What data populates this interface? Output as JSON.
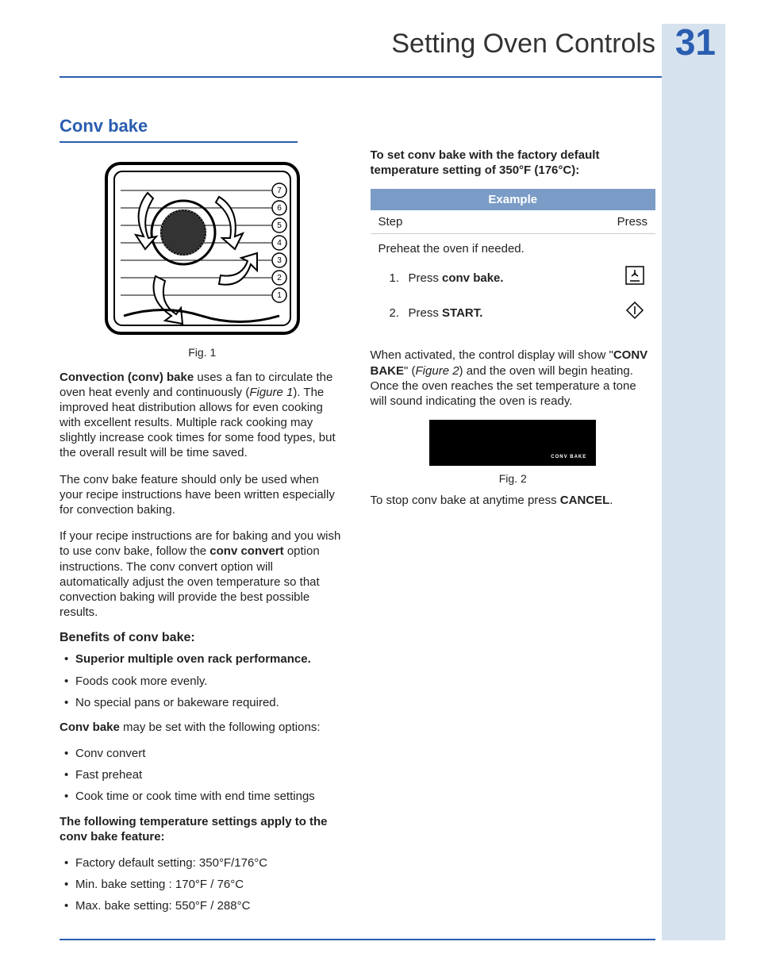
{
  "header": {
    "title": "Setting Oven Controls",
    "page_number": "31"
  },
  "section": {
    "heading": "Conv bake"
  },
  "fig1": {
    "caption": "Fig. 1",
    "rack_labels": [
      "7",
      "6",
      "5",
      "4",
      "3",
      "2",
      "1"
    ]
  },
  "left": {
    "p1_a": "Convection (conv) bake",
    "p1_b": " uses a fan to circulate the oven heat evenly and continuously (",
    "p1_c": "Figure 1",
    "p1_d": "). The improved heat distribution allows for even cooking with excellent results. Multiple rack cooking may slightly increase cook times for some food types, but the overall result will be time saved.",
    "p2": "The conv bake feature should only be used when your recipe instructions have been written especially for convection baking.",
    "p3_a": "If your recipe instructions are for baking and you wish to use conv bake, follow the ",
    "p3_b": "conv convert",
    "p3_c": " option instructions. The conv convert option will automatically adjust the oven temperature so that convection baking will provide the best possible results.",
    "benefits_heading": "Benefits of conv bake:",
    "benefits": [
      {
        "text": "Superior multiple oven rack performance.",
        "bold": true
      },
      {
        "text": "Foods cook more evenly.",
        "bold": false
      },
      {
        "text": "No special pans or bakeware required.",
        "bold": false
      }
    ],
    "options_intro_a": "Conv bake",
    "options_intro_b": " may be set with the following options:",
    "options": [
      "Conv convert",
      "Fast preheat",
      "Cook time or cook time with end time settings"
    ],
    "temp_heading": "The following temperature settings apply to the conv bake feature:",
    "temps": [
      "Factory default setting:  350°F/176°C",
      "Min. bake setting : 170°F / 76°C",
      "Max. bake setting: 550°F / 288°C"
    ]
  },
  "right": {
    "intro": "To set conv bake with the factory default temperature setting of 350°F (176°C):",
    "table": {
      "title": "Example",
      "col1": "Step",
      "col2": "Press",
      "preheat": "Preheat the oven if needed.",
      "steps": [
        {
          "n": "1.",
          "pre": "Press ",
          "b": "conv bake.",
          "icon": "conv-bake-icon"
        },
        {
          "n": "2.",
          "pre": "Press ",
          "b": "START.",
          "icon": "start-icon"
        }
      ]
    },
    "after_a": "When activated, the control display will show \"",
    "after_b": "CONV BAKE",
    "after_c": "\" (",
    "after_d": "Figure 2",
    "after_e": ") and the oven will begin heating. Once the oven reaches the set temperature a tone will sound indicating the oven is ready.",
    "fig2_display": "CONV   BAKE",
    "fig2_caption": "Fig. 2",
    "stop_a": "To stop conv bake at anytime press ",
    "stop_b": "CANCEL",
    "stop_c": "."
  }
}
